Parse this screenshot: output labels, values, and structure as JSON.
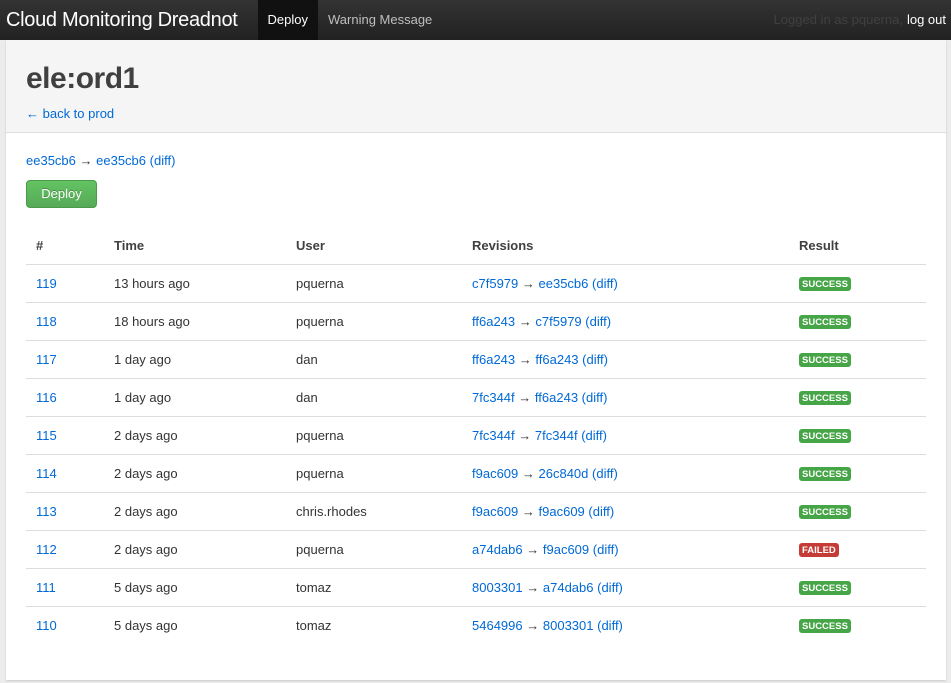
{
  "navbar": {
    "brand": "Cloud Monitoring Dreadnot",
    "tabs": [
      {
        "label": "Deploy",
        "active": true
      },
      {
        "label": "Warning Message",
        "active": false
      }
    ],
    "logged_in_text": "Logged in as pquerna,",
    "logout_label": "log out"
  },
  "header": {
    "title": "ele:ord1",
    "back_link": "← back to prod"
  },
  "current": {
    "from": "ee35cb6",
    "arrow": "→",
    "to": "ee35cb6",
    "diff_label": "(diff)"
  },
  "deploy_button": "Deploy",
  "table": {
    "headers": [
      "#",
      "Time",
      "User",
      "Revisions",
      "Result"
    ],
    "rows": [
      {
        "id": "119",
        "time": "13 hours ago",
        "user": "pquerna",
        "from": "c7f5979",
        "to": "ee35cb6",
        "diff": "(diff)",
        "result": "SUCCESS"
      },
      {
        "id": "118",
        "time": "18 hours ago",
        "user": "pquerna",
        "from": "ff6a243",
        "to": "c7f5979",
        "diff": "(diff)",
        "result": "SUCCESS"
      },
      {
        "id": "117",
        "time": "1 day ago",
        "user": "dan",
        "from": "ff6a243",
        "to": "ff6a243",
        "diff": "(diff)",
        "result": "SUCCESS"
      },
      {
        "id": "116",
        "time": "1 day ago",
        "user": "dan",
        "from": "7fc344f",
        "to": "ff6a243",
        "diff": "(diff)",
        "result": "SUCCESS"
      },
      {
        "id": "115",
        "time": "2 days ago",
        "user": "pquerna",
        "from": "7fc344f",
        "to": "7fc344f",
        "diff": "(diff)",
        "result": "SUCCESS"
      },
      {
        "id": "114",
        "time": "2 days ago",
        "user": "pquerna",
        "from": "f9ac609",
        "to": "26c840d",
        "diff": "(diff)",
        "result": "SUCCESS"
      },
      {
        "id": "113",
        "time": "2 days ago",
        "user": "chris.rhodes",
        "from": "f9ac609",
        "to": "f9ac609",
        "diff": "(diff)",
        "result": "SUCCESS"
      },
      {
        "id": "112",
        "time": "2 days ago",
        "user": "pquerna",
        "from": "a74dab6",
        "to": "f9ac609",
        "diff": "(diff)",
        "result": "FAILED"
      },
      {
        "id": "111",
        "time": "5 days ago",
        "user": "tomaz",
        "from": "8003301",
        "to": "a74dab6",
        "diff": "(diff)",
        "result": "SUCCESS"
      },
      {
        "id": "110",
        "time": "5 days ago",
        "user": "tomaz",
        "from": "5464996",
        "to": "8003301",
        "diff": "(diff)",
        "result": "SUCCESS"
      }
    ]
  },
  "colors": {
    "success": "#46a546",
    "failed": "#c43c35",
    "link": "#0069d6"
  }
}
